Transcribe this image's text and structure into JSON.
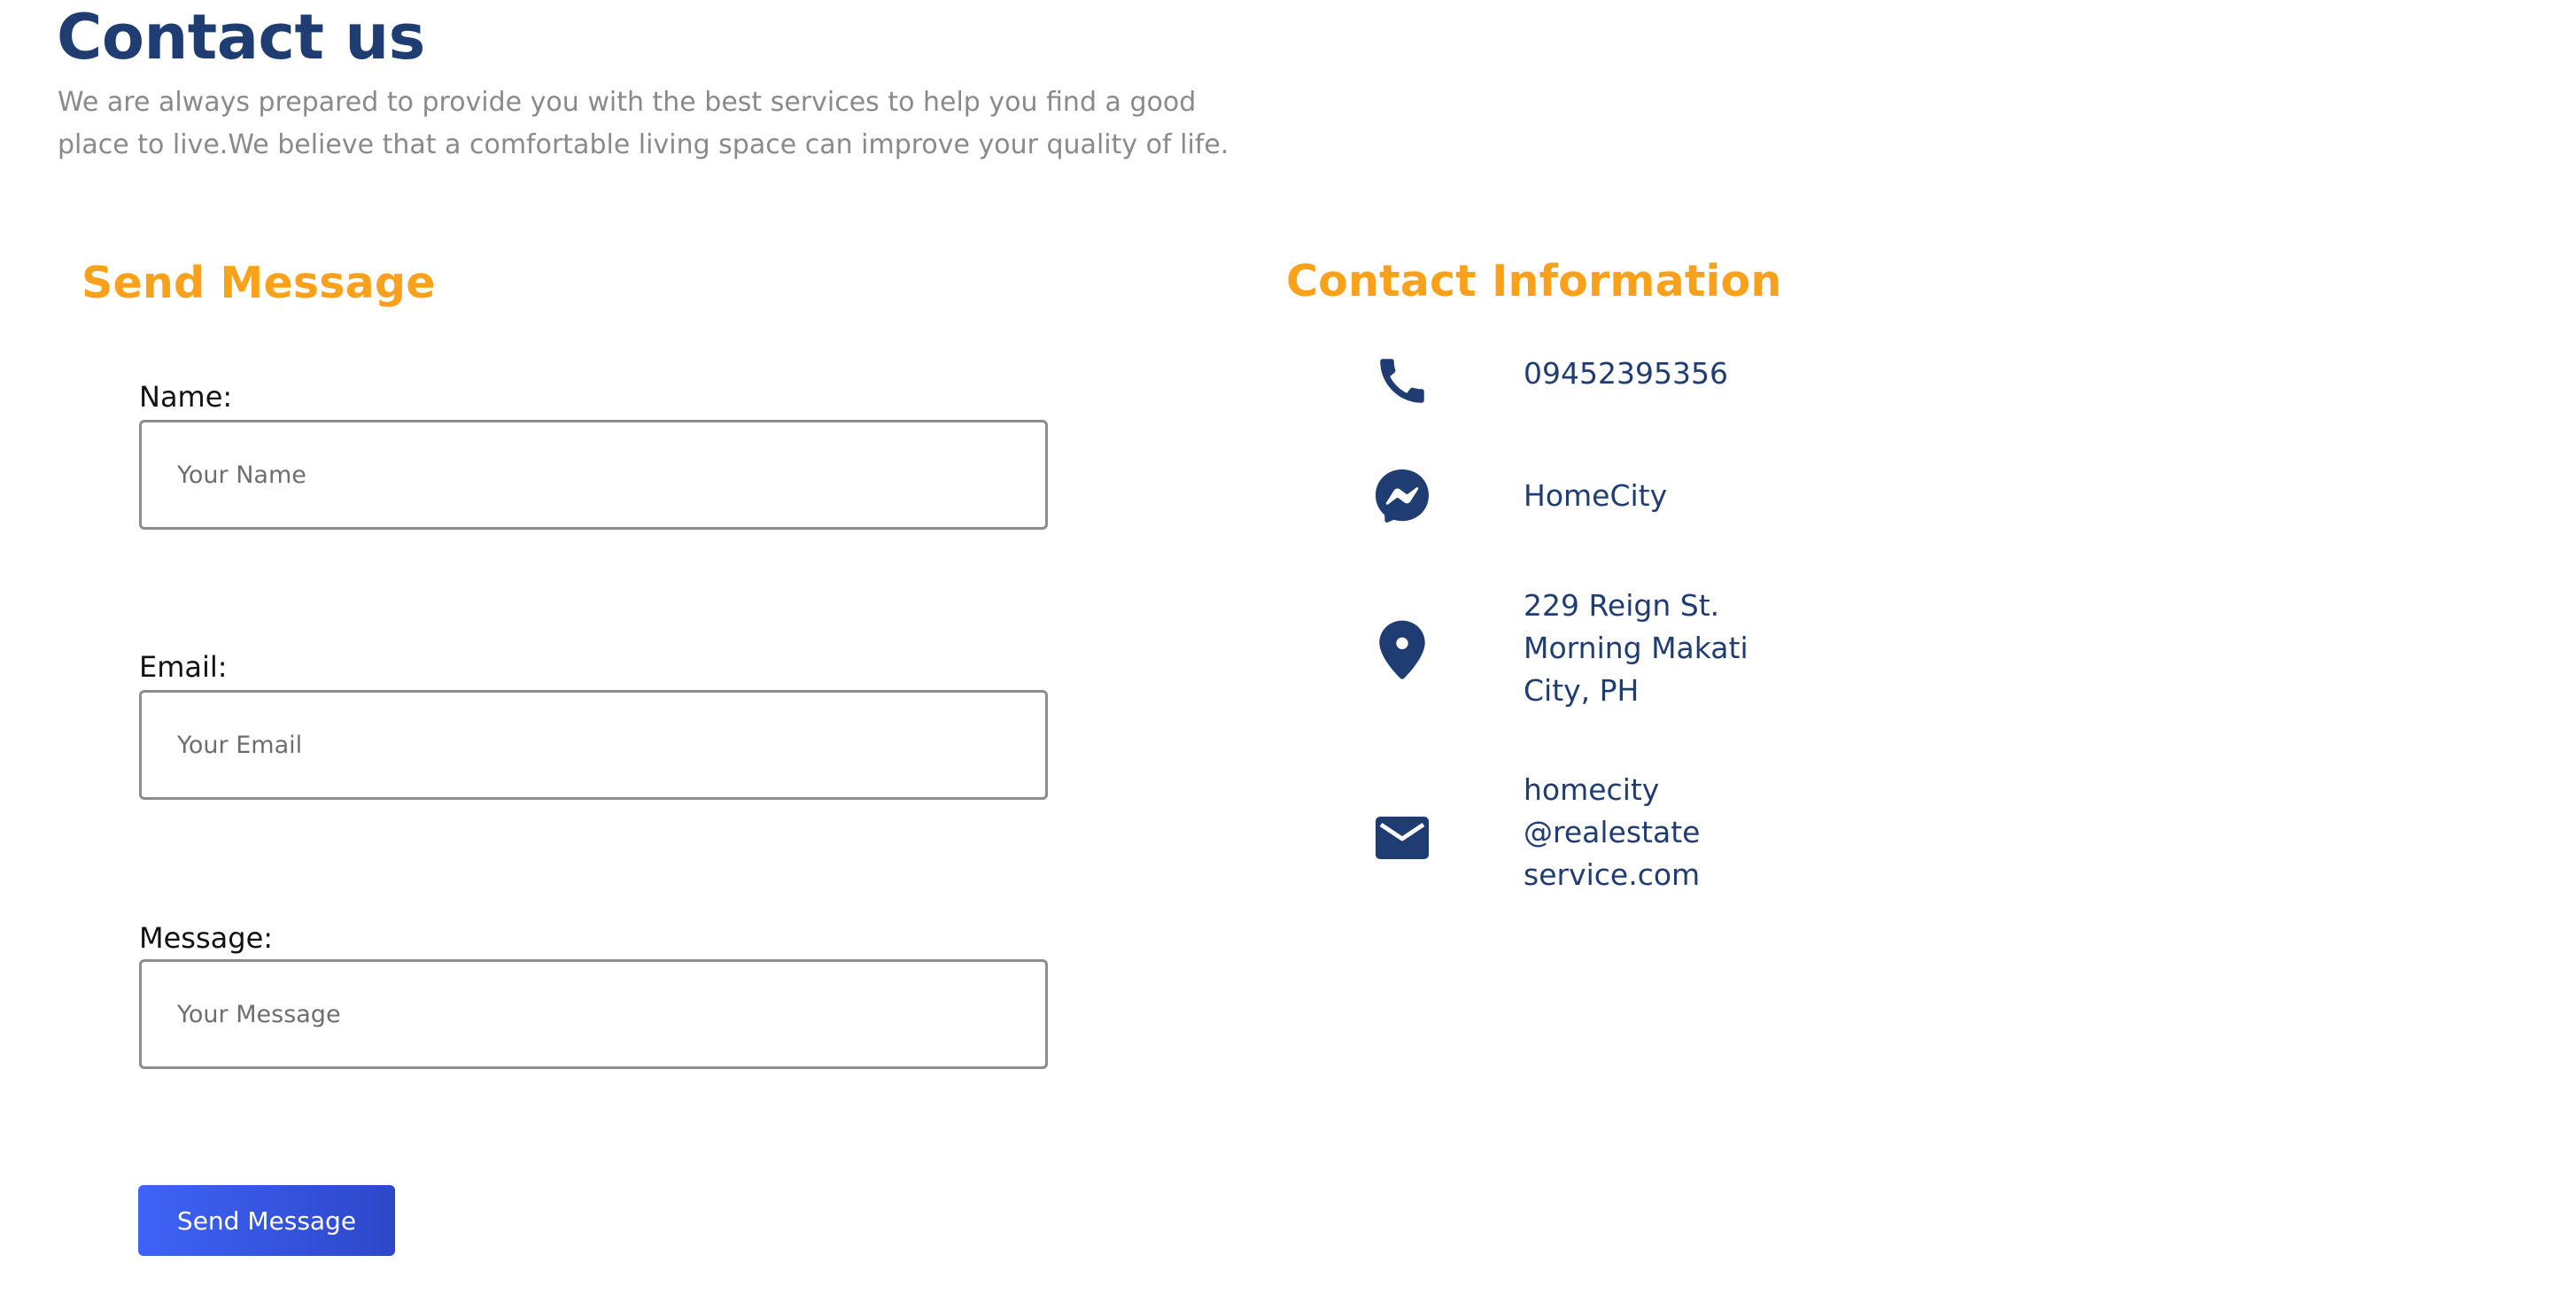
{
  "header": {
    "title": "Contact us",
    "intro": "We are always prepared to provide you with the best services to help you find a good place to live.We believe that a comfortable living space can improve your quality of life."
  },
  "form": {
    "heading": "Send Message",
    "name": {
      "label": "Name:",
      "placeholder": "Your Name",
      "value": ""
    },
    "email": {
      "label": "Email:",
      "placeholder": "Your Email",
      "value": ""
    },
    "message": {
      "label": "Message:",
      "placeholder": "Your Message",
      "value": ""
    },
    "submit_label": "Send Message"
  },
  "contact_info": {
    "heading": "Contact Information",
    "phone": {
      "icon": "phone-icon",
      "text": "09452395356"
    },
    "messenger": {
      "icon": "messenger-icon",
      "text": "HomeCity"
    },
    "address": {
      "icon": "location-pin-icon",
      "lines": [
        "229 Reign St.",
        "Morning Makati",
        "City, PH"
      ]
    },
    "email": {
      "icon": "mail-icon",
      "lines": [
        "homecity",
        "@realestate",
        "service.com"
      ]
    }
  },
  "colors": {
    "title": "#1f3d73",
    "accent": "#f9a11b",
    "button_start": "#3f63f7",
    "button_end": "#2d47c9",
    "muted_text": "#8a8a8a"
  }
}
